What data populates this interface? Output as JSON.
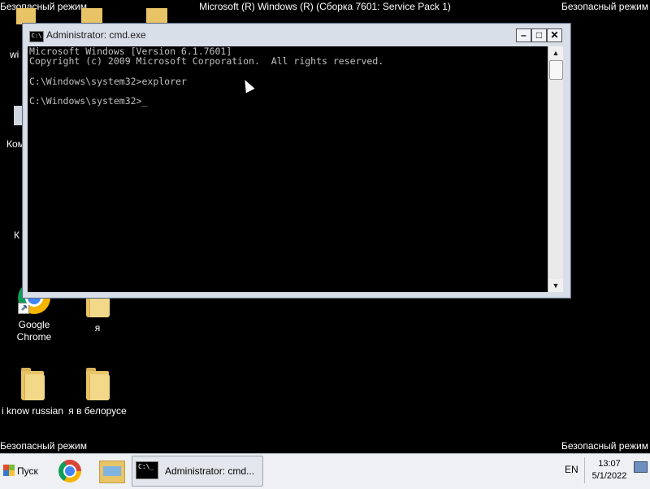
{
  "overlay": {
    "safe_mode": "Безопасный режим",
    "os_title": "Microsoft (R) Windows (R) (Сборка 7601: Service Pack 1)"
  },
  "desktop": {
    "icons": [
      {
        "label": "Google Chrome",
        "icon": "chrome-icon"
      },
      {
        "label": "я",
        "icon": "folder-icon"
      },
      {
        "label": "i know russian",
        "icon": "folder-icon"
      },
      {
        "label": "я в белорусе",
        "icon": "folder-icon"
      }
    ],
    "partial_labels": [
      "wi",
      "Ком",
      "К"
    ]
  },
  "cmd_window": {
    "title": "Administrator: cmd.exe",
    "icon_text": "C:\\",
    "lines": [
      "Microsoft Windows [Version 6.1.7601]",
      "Copyright (c) 2009 Microsoft Corporation.  All rights reserved.",
      "",
      "C:\\Windows\\system32>explorer",
      "",
      "C:\\Windows\\system32>"
    ],
    "buttons": {
      "minimize": "–",
      "maximize": "□",
      "close": "✕"
    },
    "colors": {
      "background": "#000000",
      "text": "#c0c0c0"
    }
  },
  "taskbar": {
    "start_label": "Пуск",
    "pinned": [
      "chrome-icon",
      "explorer-icon"
    ],
    "active_task": {
      "label": "Administrator: cmd...",
      "icon_text": "C:\\_"
    },
    "language": "EN",
    "clock": {
      "time": "13:07",
      "date": "5/1/2022"
    }
  }
}
